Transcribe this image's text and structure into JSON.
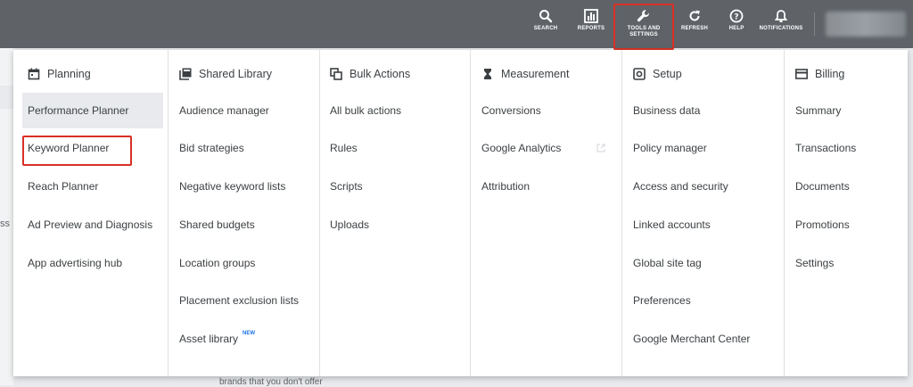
{
  "topbar": {
    "items": [
      {
        "label": "SEARCH",
        "icon": "search-icon"
      },
      {
        "label": "REPORTS",
        "icon": "reports-icon"
      },
      {
        "label_line1": "TOOLS AND",
        "label_line2": "SETTINGS",
        "icon": "wrench-icon"
      },
      {
        "label": "REFRESH",
        "icon": "refresh-icon"
      },
      {
        "label": "HELP",
        "icon": "help-icon"
      },
      {
        "label": "NOTIFICATIONS",
        "icon": "bell-icon"
      }
    ]
  },
  "background": {
    "partial_text": "brands that you don't offer",
    "left_partial": "ss"
  },
  "menu": {
    "columns": [
      {
        "heading": "Planning",
        "icon": "calendar-icon",
        "items": [
          "Performance Planner",
          "Keyword Planner",
          "Reach Planner",
          "Ad Preview and Diagnosis",
          "App advertising hub"
        ]
      },
      {
        "heading": "Shared Library",
        "icon": "library-icon",
        "items": [
          "Audience manager",
          "Bid strategies",
          "Negative keyword lists",
          "Shared budgets",
          "Location groups",
          "Placement exclusion lists",
          "Asset library"
        ],
        "badge": "NEW"
      },
      {
        "heading": "Bulk Actions",
        "icon": "copy-icon",
        "items": [
          "All bulk actions",
          "Rules",
          "Scripts",
          "Uploads"
        ]
      },
      {
        "heading": "Measurement",
        "icon": "hourglass-icon",
        "items": [
          "Conversions",
          "Google Analytics",
          "Attribution"
        ]
      },
      {
        "heading": "Setup",
        "icon": "setup-icon",
        "items": [
          "Business data",
          "Policy manager",
          "Access and security",
          "Linked accounts",
          "Global site tag",
          "Preferences",
          "Google Merchant Center"
        ]
      },
      {
        "heading": "Billing",
        "icon": "credit-card-icon",
        "items": [
          "Summary",
          "Transactions",
          "Documents",
          "Promotions",
          "Settings"
        ]
      }
    ]
  },
  "colors": {
    "topbar": "#5f6368",
    "highlight": "#d93025",
    "text": "#3c4043",
    "active_row": "#e8eaed",
    "badge": "#1a73e8"
  }
}
